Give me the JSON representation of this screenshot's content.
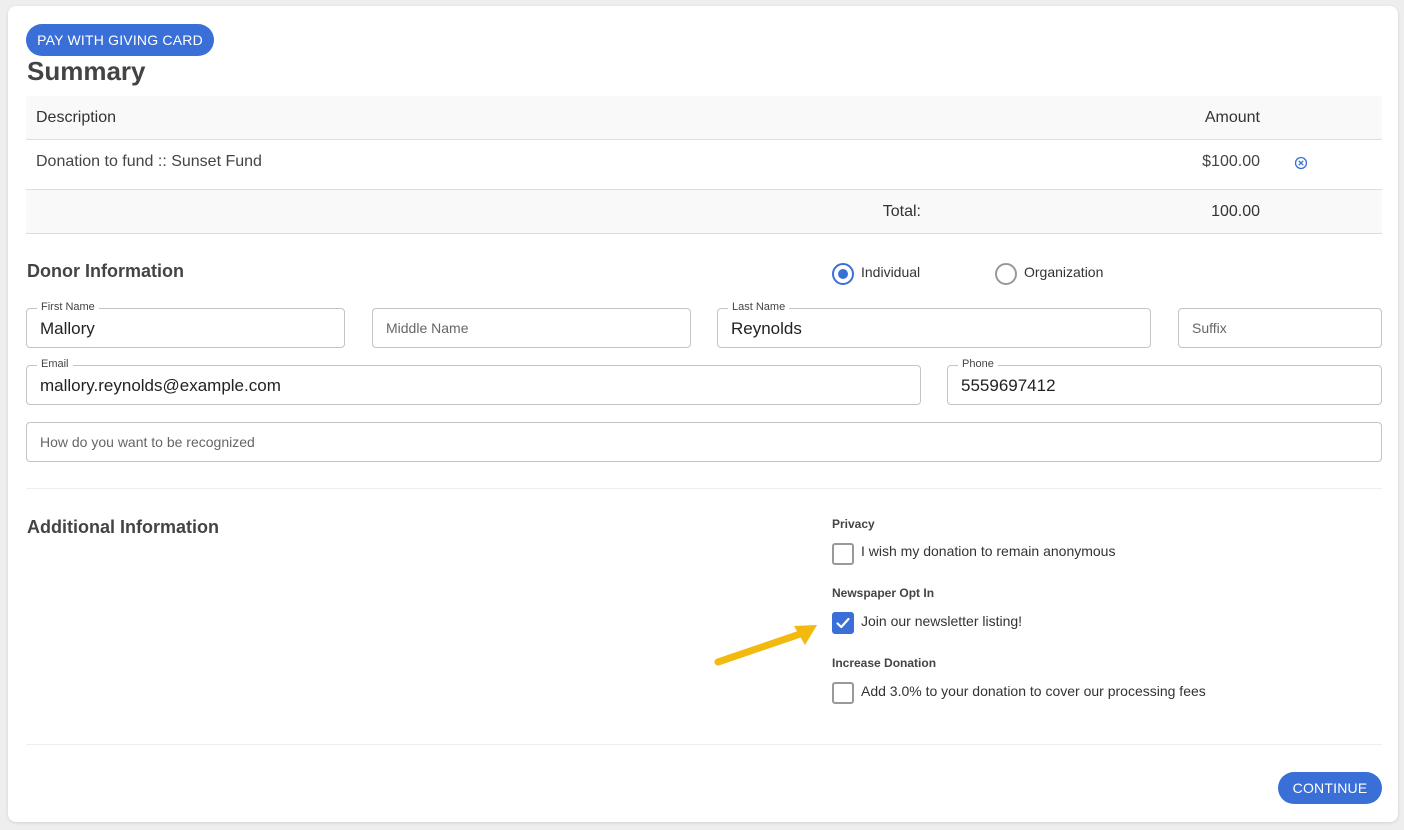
{
  "actions": {
    "giving_card_label": "PAY WITH GIVING CARD",
    "continue_label": "CONTINUE"
  },
  "summary": {
    "title": "Summary",
    "headers": {
      "description": "Description",
      "amount": "Amount"
    },
    "rows": [
      {
        "description": "Donation to fund :: Sunset Fund",
        "amount": "$100.00"
      }
    ],
    "total_label": "Total:",
    "total_value": "100.00"
  },
  "donor": {
    "title": "Donor Information",
    "type_options": {
      "individual": "Individual",
      "organization": "Organization"
    },
    "selected_type": "Individual",
    "first_name": {
      "label": "First Name",
      "value": "Mallory"
    },
    "middle_name": {
      "placeholder": "Middle Name"
    },
    "last_name": {
      "label": "Last Name",
      "value": "Reynolds"
    },
    "suffix": {
      "placeholder": "Suffix"
    },
    "email": {
      "label": "Email",
      "value": "mallory.reynolds@example.com"
    },
    "phone": {
      "label": "Phone",
      "value": "5559697412"
    },
    "recognition": {
      "placeholder": "How do you want to be recognized"
    }
  },
  "additional": {
    "title": "Additional Information",
    "privacy": {
      "label": "Privacy",
      "option": "I wish my donation to remain anonymous",
      "checked": false
    },
    "newsletter": {
      "label": "Newspaper Opt In",
      "option": "Join our newsletter listing!",
      "checked": true
    },
    "increase": {
      "label": "Increase Donation",
      "option": "Add 3.0% to your donation to cover our processing fees",
      "checked": false
    }
  },
  "colors": {
    "primary": "#3a6fd8",
    "annotation_arrow": "#f2b90f"
  },
  "icons": {
    "remove": "close-circle-icon",
    "check": "check-icon"
  }
}
